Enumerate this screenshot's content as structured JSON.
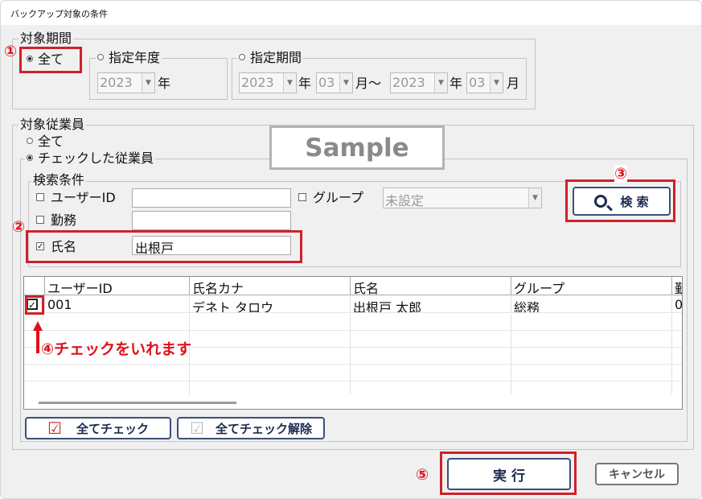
{
  "window": {
    "title": "バックアップ対象の条件"
  },
  "period": {
    "legend": "対象期間",
    "all_label": "全て",
    "year_label": "指定年度",
    "range_label": "指定期間",
    "year_value": "2023",
    "year_suffix": "年",
    "from_year": "2023",
    "from_month": "03",
    "to_year": "2023",
    "to_month": "03",
    "year_unit": "年",
    "month_unit": "月",
    "tilde": "～"
  },
  "employees": {
    "legend": "対象従業員",
    "all_label": "全て",
    "checked_label": "チェックした従業員",
    "search_legend": "検索条件",
    "userid_label": "ユーザーID",
    "group_label": "グループ",
    "group_value": "未設定",
    "work_label": "勤務",
    "name_label": "氏名",
    "name_value": "出根戸",
    "search_button": "検 索"
  },
  "watermark": "Sample",
  "table": {
    "headers": [
      "ユーザーID",
      "氏名カナ",
      "氏名",
      "グループ",
      "勤"
    ],
    "rows": [
      [
        "001",
        "デネト タロウ",
        "出根戸 太郎",
        "総務",
        "0"
      ]
    ]
  },
  "buttons": {
    "check_all": "全てチェック",
    "uncheck_all": "全てチェック解除",
    "run": "実 行",
    "cancel": "キャンセル"
  },
  "annotations": {
    "n1": "①",
    "n2": "②",
    "n3": "③",
    "n4": "④チェックをいれます",
    "n5": "⑤"
  },
  "colors": {
    "annotation_red": "#d0202a",
    "button_border": "#3b4f7a"
  }
}
